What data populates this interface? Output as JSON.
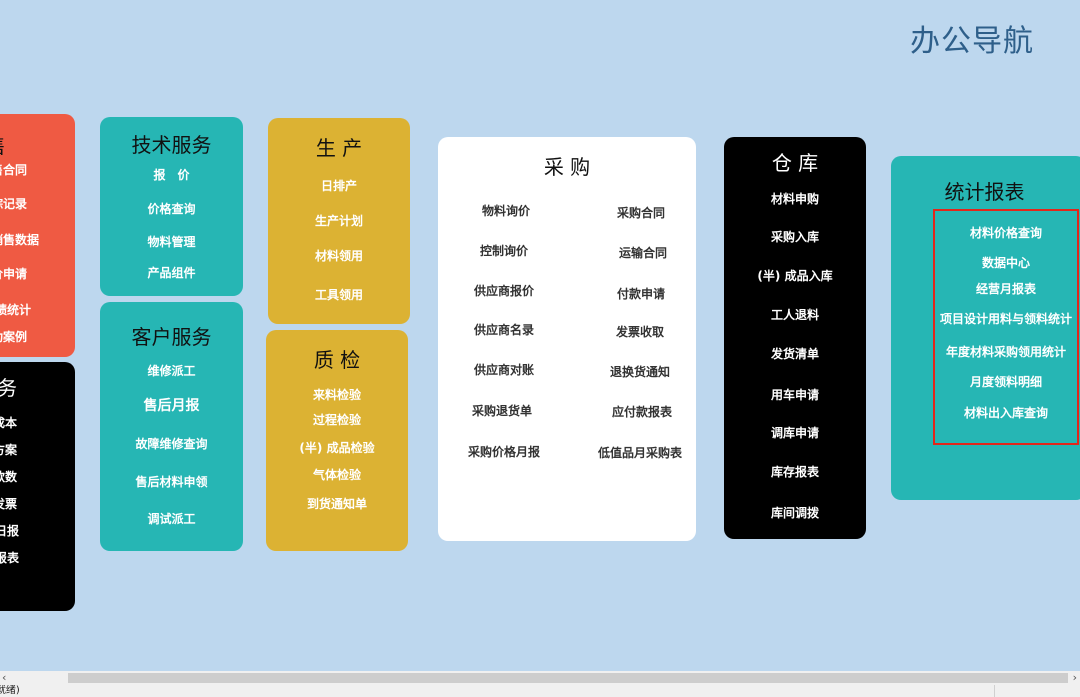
{
  "page_title": "办公导航",
  "colors": {
    "background": "#bdd7ee",
    "red": "#ef5a43",
    "teal": "#26b6b4",
    "gold": "#dcb233",
    "black": "#000000",
    "white": "#ffffff",
    "highlight": "#e3261b"
  },
  "sales": {
    "title": "销 售",
    "items": [
      "销售合同",
      "跟踪记录",
      "销售数据",
      "报价申请",
      "业绩统计",
      "成功案例"
    ]
  },
  "finance": {
    "title": "财 务",
    "items": [
      "成本",
      "方案",
      "款数",
      "发票",
      "日报",
      "报表"
    ]
  },
  "tech_service": {
    "title": "技术服务",
    "items": [
      "报　价",
      "价格查询",
      "物料管理",
      "产品组件"
    ]
  },
  "customer_service": {
    "title": "客户服务",
    "items": [
      "维修派工",
      "售后月报",
      "故障维修查询",
      "售后材料申领",
      "调试派工"
    ]
  },
  "production": {
    "title": "生 产",
    "items": [
      "日排产",
      "生产计划",
      "材料领用",
      "工具领用"
    ]
  },
  "quality": {
    "title": "质 检",
    "items": [
      "来料检验",
      "过程检验",
      "(半) 成品检验",
      "气体检验",
      "到货通知单"
    ]
  },
  "purchase": {
    "title": "采 购",
    "left": [
      "物料询价",
      "控制询价",
      "供应商报价",
      "供应商名录",
      "供应商对账",
      "采购退货单",
      "采购价格月报"
    ],
    "right": [
      "采购合同",
      "运输合同",
      "付款申请",
      "发票收取",
      "退换货通知",
      "应付款报表",
      "低值品月采购表"
    ]
  },
  "warehouse": {
    "title": "仓 库",
    "items": [
      "材料申购",
      "采购入库",
      "(半) 成品入库",
      "工人退料",
      "发货清单",
      "用车申请",
      "调库申请",
      "库存报表",
      "库间调拨"
    ]
  },
  "stats": {
    "title": "统计报表",
    "items": [
      "材料价格查询",
      "数据中心",
      "经营月报表",
      "项目设计用料与领料统计",
      "年度材料采购领用统计",
      "月度领料明细",
      "材料出入库查询"
    ]
  },
  "scrollbar": {
    "left_arrow": "‹",
    "right_arrow": "›"
  },
  "status": {
    "text": "(就绪)"
  }
}
